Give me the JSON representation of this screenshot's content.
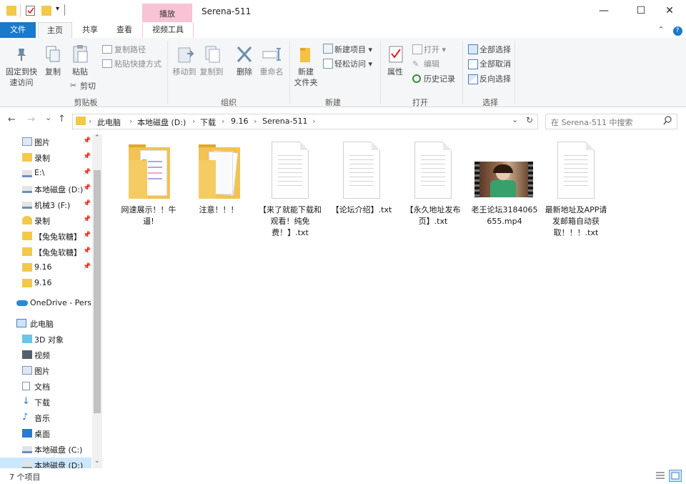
{
  "window": {
    "title": "Serena-511",
    "context_tab": "播放",
    "minimize": "—",
    "maximize": "☐",
    "close": "✕"
  },
  "tabs": {
    "file": "文件",
    "home": "主页",
    "share": "共享",
    "view": "查看",
    "video_tools": "视频工具",
    "collapse": "⌃",
    "help": "?"
  },
  "ribbon": {
    "clipboard": {
      "pin_label": "固定到快\n速访问",
      "copy_label": "复制",
      "paste_label": "粘贴",
      "copy_path": "复制路径",
      "paste_shortcut": "粘贴快捷方式",
      "cut": "剪切",
      "group_label": "剪贴板"
    },
    "organize": {
      "move_to": "移动到",
      "copy_to": "复制到",
      "delete": "删除",
      "rename": "重命名",
      "group_label": "组织"
    },
    "new": {
      "new_folder": "新建\n文件夹",
      "new_item": "新建项目 ▾",
      "easy_access": "轻松访问 ▾",
      "group_label": "新建"
    },
    "open": {
      "properties": "属性",
      "open": "打开 ▾",
      "edit": "编辑",
      "history": "历史记录",
      "group_label": "打开"
    },
    "select": {
      "select_all": "全部选择",
      "select_none": "全部取消",
      "invert": "反向选择",
      "group_label": "选择"
    }
  },
  "address": {
    "back": "←",
    "forward": "→",
    "recent": "⌄",
    "up": "↑",
    "crumbs": [
      "此电脑",
      "本地磁盘 (D:)",
      "下载",
      "9.16",
      "Serena-511"
    ],
    "sep": "›",
    "dropdown": "⌄",
    "refresh": "↻",
    "search_placeholder": "在 Serena-511 中搜索"
  },
  "nav": {
    "quick": [
      {
        "label": "图片",
        "pinned": true,
        "icon": "pictures-icon"
      },
      {
        "label": "录制",
        "pinned": true,
        "icon": "folder-icon"
      },
      {
        "label": "E:\\",
        "pinned": true,
        "icon": "drive-icon"
      },
      {
        "label": "本地磁盘 (D:)",
        "pinned": true,
        "icon": "drive-icon"
      },
      {
        "label": "机械3 (F:)",
        "pinned": true,
        "icon": "drive-icon"
      },
      {
        "label": "录制",
        "pinned": true,
        "icon": "user-folder-icon"
      },
      {
        "label": "【兔兔软糖】",
        "pinned": true,
        "icon": "folder-icon"
      },
      {
        "label": "【兔兔软糖】",
        "pinned": true,
        "icon": "folder-icon"
      },
      {
        "label": "9.16",
        "pinned": true,
        "icon": "folder-icon"
      },
      {
        "label": "9.16",
        "pinned": false,
        "icon": "folder-icon"
      }
    ],
    "onedrive": "OneDrive - Personal",
    "this_pc": "此电脑",
    "pc_items": [
      {
        "label": "3D 对象",
        "icon": "3d-objects-icon"
      },
      {
        "label": "视频",
        "icon": "videos-icon"
      },
      {
        "label": "图片",
        "icon": "pictures-icon"
      },
      {
        "label": "文档",
        "icon": "documents-icon"
      },
      {
        "label": "下载",
        "icon": "downloads-icon"
      },
      {
        "label": "音乐",
        "icon": "music-icon"
      },
      {
        "label": "桌面",
        "icon": "desktop-icon"
      },
      {
        "label": "本地磁盘 (C:)",
        "icon": "drive-icon"
      },
      {
        "label": "本地磁盘 (D:)",
        "icon": "drive-icon"
      }
    ],
    "pin_glyph": "📌",
    "scroll_up": "⌃",
    "scroll_down": "⌄"
  },
  "files": [
    {
      "name": "网速展示！！牛逼!",
      "type": "folder-preview"
    },
    {
      "name": "注意！！！",
      "type": "folder-docs"
    },
    {
      "name": "【来了就能下载和观看！纯免费！】.txt",
      "type": "txt"
    },
    {
      "name": "【论坛介绍】.txt",
      "type": "txt"
    },
    {
      "name": "【永久地址发布页】.txt",
      "type": "txt"
    },
    {
      "name": "老王论坛3184065655.mp4",
      "type": "video"
    },
    {
      "name": "最新地址及APP请发邮箱自动获取！！！.txt",
      "type": "txt"
    }
  ],
  "status": {
    "count": "7 个项目"
  }
}
